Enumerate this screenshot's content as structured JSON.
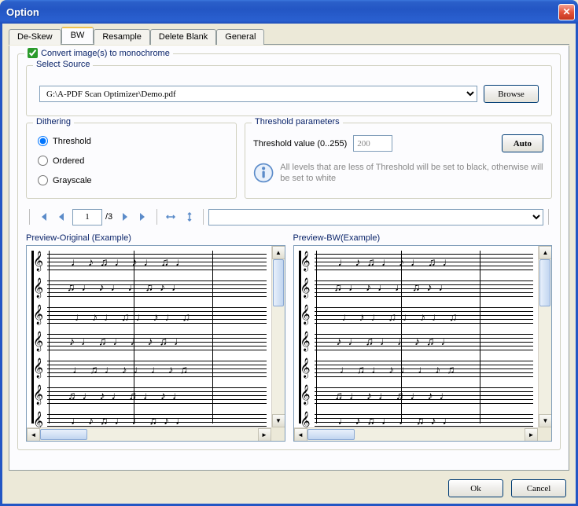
{
  "window": {
    "title": "Option"
  },
  "tabs": [
    "De-Skew",
    "BW",
    "Resample",
    "Delete Blank",
    "General"
  ],
  "active_tab": 1,
  "convert_check": {
    "label": "Convert image(s) to monochrome",
    "checked": true
  },
  "source": {
    "title": "Select Source",
    "value": "G:\\A-PDF Scan Optimizer\\Demo.pdf",
    "browse": "Browse"
  },
  "dithering": {
    "title": "Dithering",
    "options": [
      "Threshold",
      "Ordered",
      "Grayscale"
    ],
    "selected": 0
  },
  "threshold": {
    "title": "Threshold parameters",
    "label": "Threshold value (0..255)",
    "value": "200",
    "auto": "Auto",
    "info": "All levels that are less of Threshold will be set to black, otherwise will be set to white"
  },
  "nav": {
    "page": "1",
    "total": "/3",
    "zoom": ""
  },
  "preview": {
    "orig": "Preview-Original (Example)",
    "bw": "Preview-BW(Example)"
  },
  "buttons": {
    "ok": "Ok",
    "cancel": "Cancel"
  }
}
